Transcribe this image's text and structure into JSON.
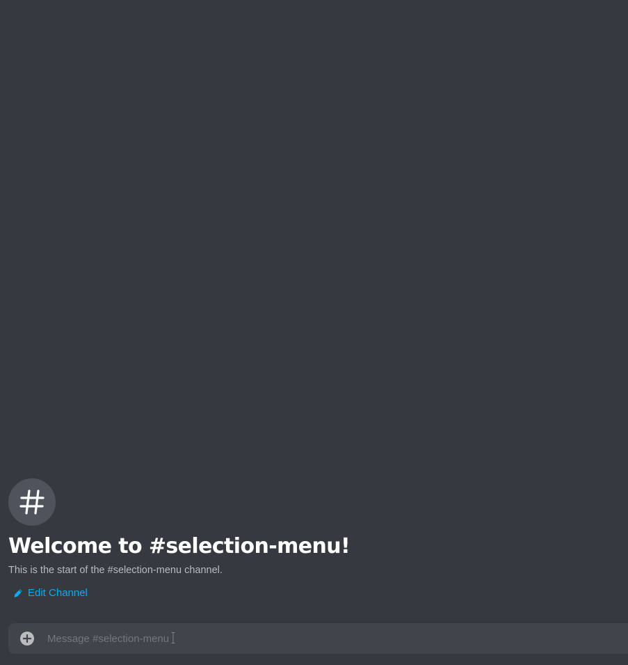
{
  "welcome": {
    "icon": "hash-icon",
    "title": "Welcome to #selection-menu!",
    "subtitle": "This is the start of the #selection-menu channel.",
    "edit_label": "Edit Channel",
    "edit_icon": "pencil-icon"
  },
  "composer": {
    "attach_icon": "plus-circle-icon",
    "placeholder": "Message #selection-menu",
    "value": ""
  },
  "colors": {
    "background": "#36393f",
    "composer_bg": "#40444b",
    "link": "#00b0f4",
    "title": "#ffffff",
    "muted": "#b9bbbe"
  }
}
